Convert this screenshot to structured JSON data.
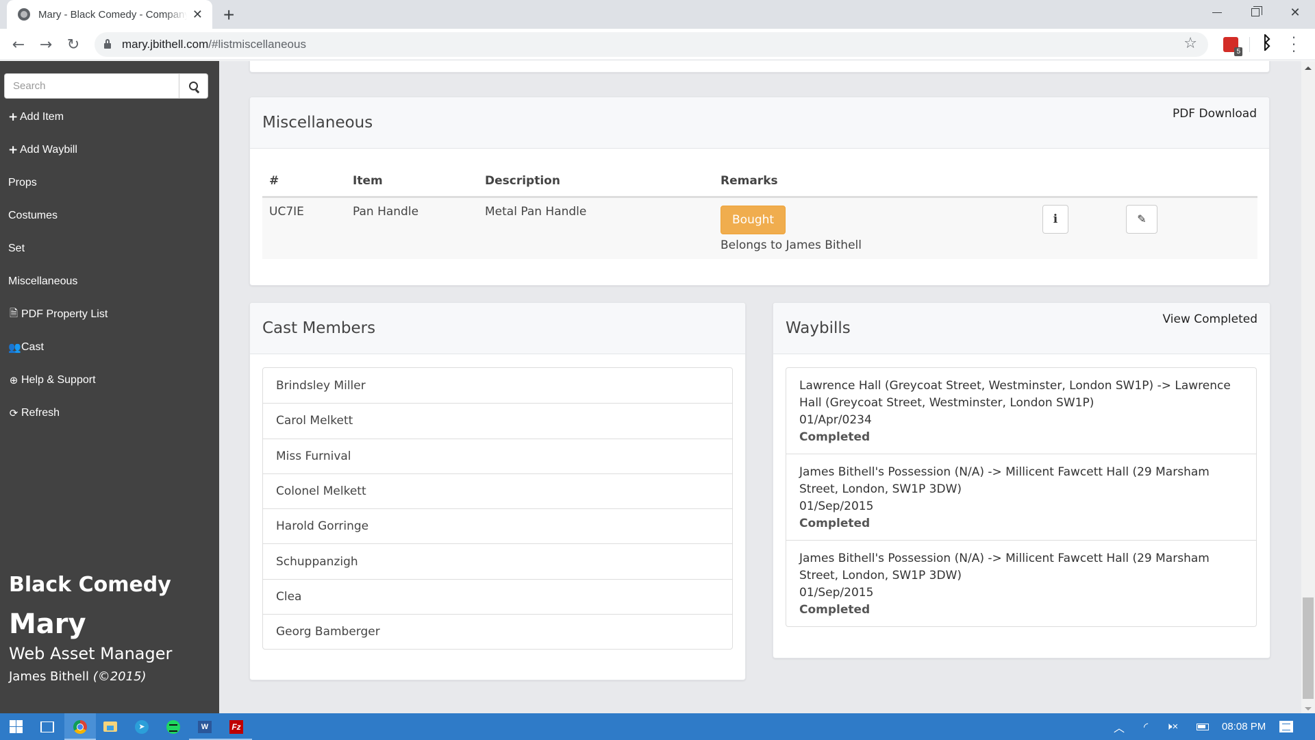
{
  "browser": {
    "tab_title": "Mary - Black Comedy - Company",
    "url_host": "mary.jbithell.com",
    "url_path": "/#listmiscellaneous",
    "extension_badge": "5"
  },
  "sidebar": {
    "search_placeholder": "Search",
    "items": [
      {
        "label": "Add Item",
        "icon": "plus-icon"
      },
      {
        "label": "Add Waybill",
        "icon": "plus-icon"
      },
      {
        "label": "Props",
        "icon": ""
      },
      {
        "label": "Costumes",
        "icon": ""
      },
      {
        "label": "Set",
        "icon": ""
      },
      {
        "label": "Miscellaneous",
        "icon": ""
      },
      {
        "label": "PDF Property List",
        "icon": "pdf-file-icon"
      },
      {
        "label": "Cast",
        "icon": "users-icon"
      },
      {
        "label": "Help & Support",
        "icon": "life-ring-icon"
      },
      {
        "label": "Refresh",
        "icon": "refresh-icon"
      }
    ],
    "brand": {
      "show_name": "Black Comedy",
      "app_name": "Mary",
      "subtitle": "Web Asset Manager",
      "author": "James Bithell",
      "copyright": "(©2015)"
    }
  },
  "miscellaneous": {
    "title": "Miscellaneous",
    "pdf_link": "PDF Download",
    "columns": [
      "#",
      "Item",
      "Description",
      "Remarks"
    ],
    "rows": [
      {
        "id": "UC7IE",
        "item": "Pan Handle",
        "description": "Metal Pan Handle",
        "status_badge": "Bought",
        "remark": "Belongs to James Bithell"
      }
    ],
    "colors": {
      "badge": "#f0ad4e"
    }
  },
  "cast": {
    "title": "Cast Members",
    "members": [
      "Brindsley Miller",
      "Carol Melkett",
      "Miss Furnival",
      "Colonel Melkett",
      "Harold Gorringe",
      "Schuppanzigh",
      "Clea",
      "Georg Bamberger"
    ]
  },
  "waybills": {
    "title": "Waybills",
    "view_completed": "View Completed",
    "items": [
      {
        "route": "Lawrence Hall (Greycoat Street, Westminster, London SW1P) -> Lawrence Hall (Greycoat Street, Westminster, London SW1P)",
        "date": "01/Apr/0234",
        "status": "Completed"
      },
      {
        "route": "James Bithell's Possession (N/A) -> Millicent Fawcett Hall (29 Marsham Street, London, SW1P 3DW)",
        "date": "01/Sep/2015",
        "status": "Completed"
      },
      {
        "route": "James Bithell's Possession (N/A) -> Millicent Fawcett Hall (29 Marsham Street, London, SW1P 3DW)",
        "date": "01/Sep/2015",
        "status": "Completed"
      }
    ]
  },
  "taskbar": {
    "clock": "08:08 PM",
    "apps": [
      "start",
      "task-view",
      "chrome",
      "file-explorer",
      "telegram",
      "spotify",
      "word",
      "filezilla"
    ]
  }
}
